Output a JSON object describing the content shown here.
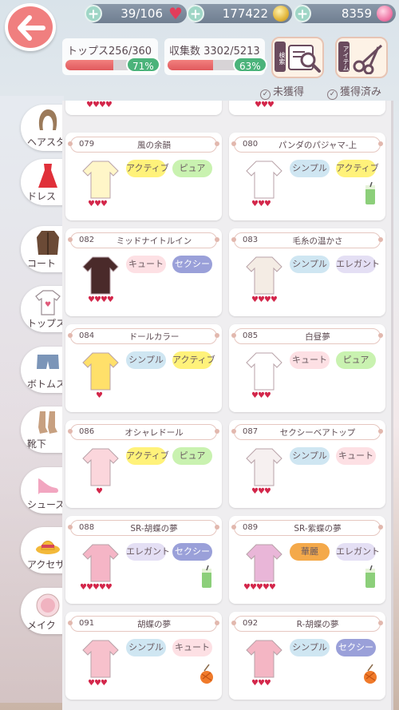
{
  "resources": {
    "hearts": "39/106",
    "coins": "177422",
    "gems": "8359"
  },
  "stats": {
    "tops_label": "トップス256/360",
    "tops_percent": "71%",
    "tops_ratio": 0.71,
    "collection_label": "収集数 3302/5213",
    "collection_percent": "63%",
    "collection_ratio": 0.63
  },
  "tools": {
    "search_tag": "検索",
    "item_tag": "アイテム"
  },
  "filters": {
    "unobtained": "未獲得",
    "obtained": "獲得済み"
  },
  "categories": [
    {
      "label": "ヘアスタイル"
    },
    {
      "label": "ドレス"
    },
    {
      "label": "コート"
    },
    {
      "label": "トップス"
    },
    {
      "label": "ボトムス"
    },
    {
      "label": "靴下"
    },
    {
      "label": "シューズ"
    },
    {
      "label": "アクセサリー"
    },
    {
      "label": "メイク"
    }
  ],
  "partial_hearts": [
    "♥♥♥♥",
    "♥♥♥"
  ],
  "items": [
    {
      "num": "079",
      "name": "風の余韻",
      "tags": [
        "アクティブ",
        "ピュア"
      ],
      "hearts": "♥♥♥"
    },
    {
      "num": "080",
      "name": "パンダのパジャマ-上",
      "tags": [
        "シンプル",
        "アクティブ"
      ],
      "hearts": "♥♥♥"
    },
    {
      "num": "082",
      "name": "ミッドナイトルイン",
      "tags": [
        "キュート",
        "セクシー"
      ],
      "hearts": "♥♥♥♥"
    },
    {
      "num": "083",
      "name": "毛糸の温かさ",
      "tags": [
        "シンプル",
        "エレガント"
      ],
      "hearts": "♥♥♥♥"
    },
    {
      "num": "084",
      "name": "ドールカラー",
      "tags": [
        "シンプル",
        "アクティブ"
      ],
      "hearts": "♥"
    },
    {
      "num": "085",
      "name": "白昼夢",
      "tags": [
        "キュート",
        "ピュア"
      ],
      "hearts": "♥♥♥"
    },
    {
      "num": "086",
      "name": "オシャレドール",
      "tags": [
        "アクティブ",
        "ピュア"
      ],
      "hearts": "♥"
    },
    {
      "num": "087",
      "name": "セクシーベアトップ",
      "tags": [
        "シンプル",
        "キュート"
      ],
      "hearts": "♥♥♥"
    },
    {
      "num": "088",
      "name": "SR-胡蝶の夢",
      "tags": [
        "エレガント",
        "セクシー"
      ],
      "hearts": "♥♥♥♥♥"
    },
    {
      "num": "089",
      "name": "SR-紫蝶の夢",
      "tags": [
        "華麗",
        "エレガント"
      ],
      "hearts": "♥♥♥♥♥"
    },
    {
      "num": "091",
      "name": "胡蝶の夢",
      "tags": [
        "シンプル",
        "キュート"
      ],
      "hearts": "♥♥♥"
    },
    {
      "num": "092",
      "name": "R-胡蝶の夢",
      "tags": [
        "シンプル",
        "セクシー"
      ],
      "hearts": "♥♥♥"
    }
  ],
  "tag_colors": {
    "アクティブ": "#fff27a",
    "ピュア": "#c9f2b0",
    "シンプル": "#cfe6f2",
    "キュート": "#fde0e4",
    "セクシー": "#9aa0d9",
    "エレガント": "#e4dff4",
    "華麗": "#f4a94a"
  }
}
